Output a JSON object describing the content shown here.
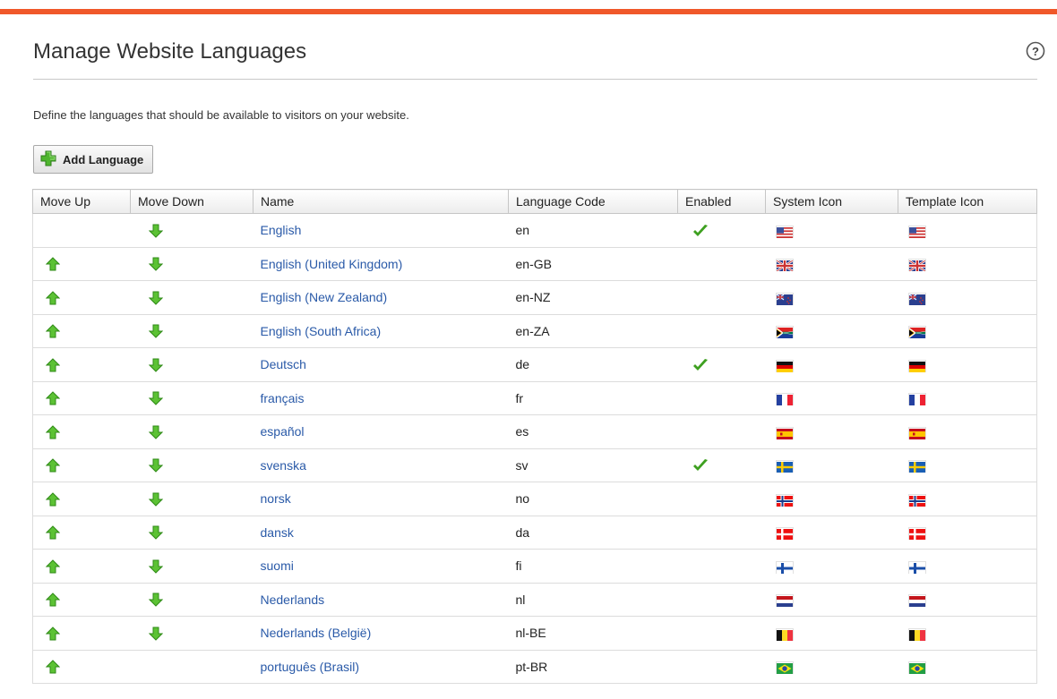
{
  "header": {
    "title": "Manage Website Languages",
    "help_icon": "help-circle-icon",
    "accent_color": "#f0582a"
  },
  "description": "Define the languages that should be available to visitors on your website.",
  "toolbar": {
    "add_label": "Add Language",
    "add_icon": "plus-icon"
  },
  "table": {
    "columns": [
      "Move Up",
      "Move Down",
      "Name",
      "Language Code",
      "Enabled",
      "System Icon",
      "Template Icon"
    ],
    "rows": [
      {
        "name": "English",
        "code": "en",
        "enabled": true,
        "move_up": false,
        "move_down": true,
        "flag": "us"
      },
      {
        "name": "English (United Kingdom)",
        "code": "en-GB",
        "enabled": false,
        "move_up": true,
        "move_down": true,
        "flag": "gb"
      },
      {
        "name": "English (New Zealand)",
        "code": "en-NZ",
        "enabled": false,
        "move_up": true,
        "move_down": true,
        "flag": "nz"
      },
      {
        "name": "English (South Africa)",
        "code": "en-ZA",
        "enabled": false,
        "move_up": true,
        "move_down": true,
        "flag": "za"
      },
      {
        "name": "Deutsch",
        "code": "de",
        "enabled": true,
        "move_up": true,
        "move_down": true,
        "flag": "de"
      },
      {
        "name": "français",
        "code": "fr",
        "enabled": false,
        "move_up": true,
        "move_down": true,
        "flag": "fr"
      },
      {
        "name": "español",
        "code": "es",
        "enabled": false,
        "move_up": true,
        "move_down": true,
        "flag": "es"
      },
      {
        "name": "svenska",
        "code": "sv",
        "enabled": true,
        "move_up": true,
        "move_down": true,
        "flag": "se"
      },
      {
        "name": "norsk",
        "code": "no",
        "enabled": false,
        "move_up": true,
        "move_down": true,
        "flag": "no"
      },
      {
        "name": "dansk",
        "code": "da",
        "enabled": false,
        "move_up": true,
        "move_down": true,
        "flag": "dk"
      },
      {
        "name": "suomi",
        "code": "fi",
        "enabled": false,
        "move_up": true,
        "move_down": true,
        "flag": "fi"
      },
      {
        "name": "Nederlands",
        "code": "nl",
        "enabled": false,
        "move_up": true,
        "move_down": true,
        "flag": "nl"
      },
      {
        "name": "Nederlands (België)",
        "code": "nl-BE",
        "enabled": false,
        "move_up": true,
        "move_down": true,
        "flag": "be"
      },
      {
        "name": "português (Brasil)",
        "code": "pt-BR",
        "enabled": false,
        "move_up": true,
        "move_down": false,
        "flag": "br"
      }
    ]
  }
}
